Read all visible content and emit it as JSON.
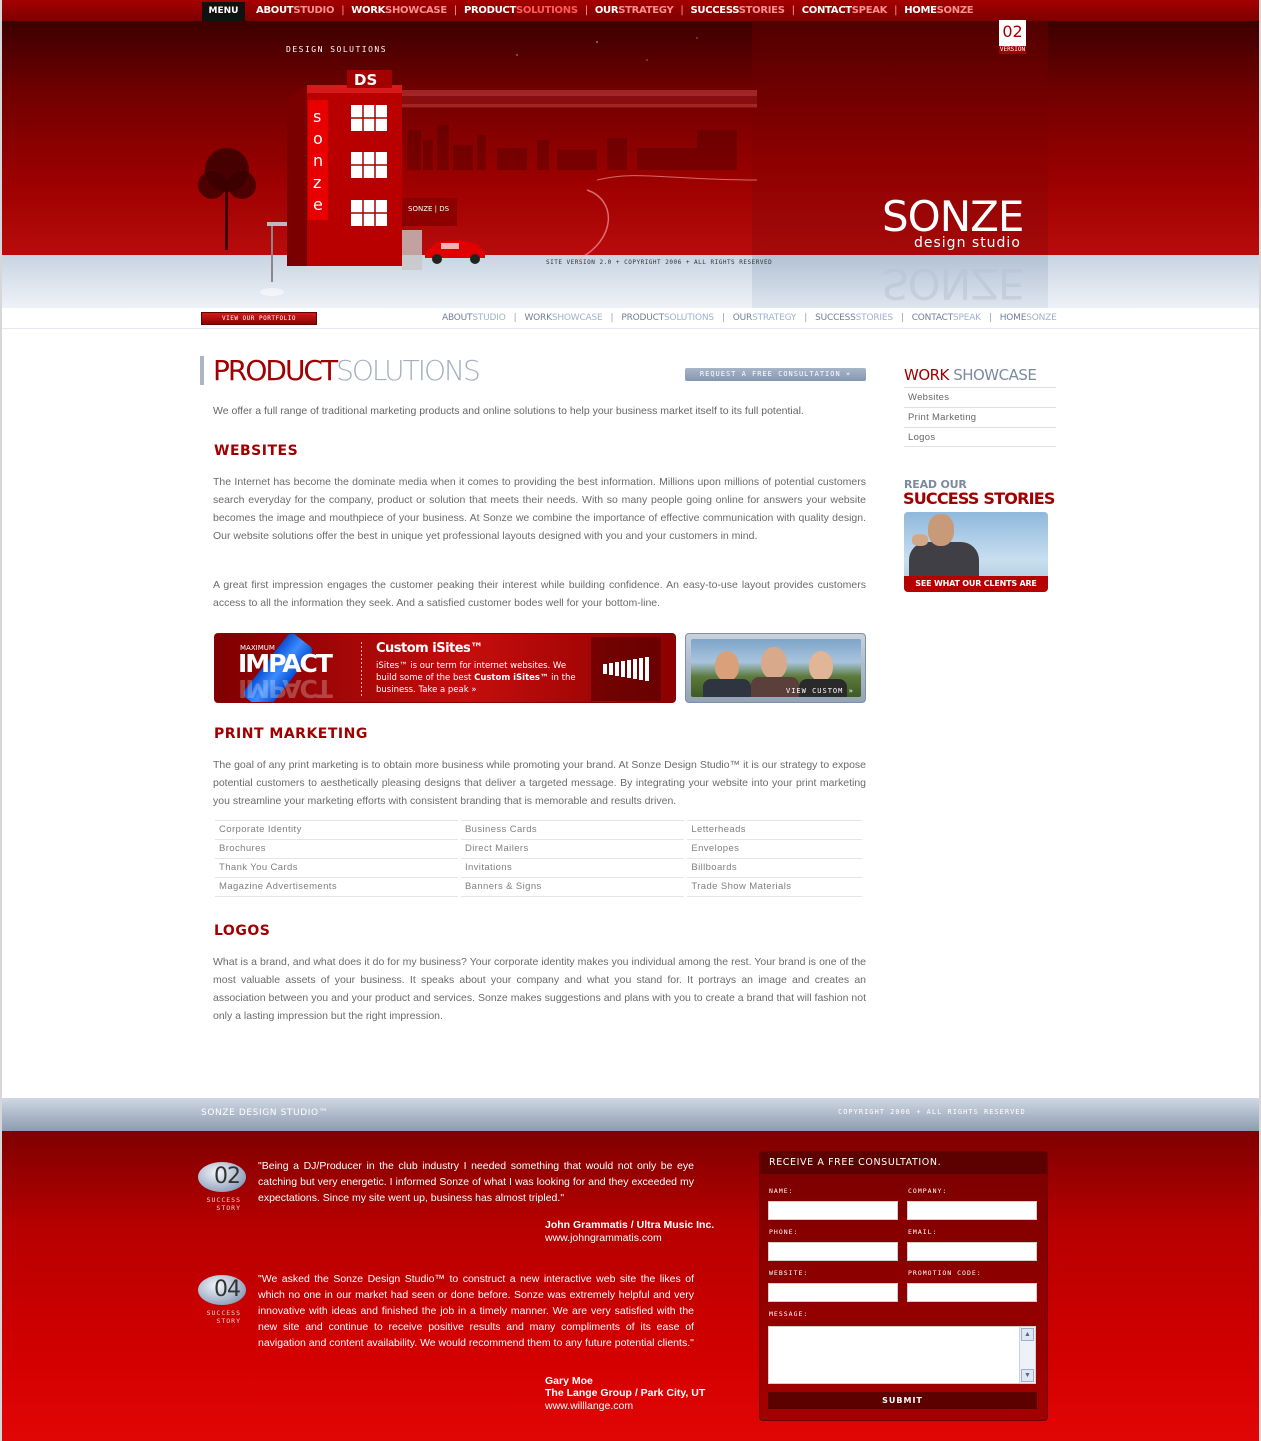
{
  "top_nav": {
    "menu_label": "MENU",
    "items": [
      {
        "a": "ABOUT",
        "b": "STUDIO"
      },
      {
        "a": "WORK",
        "b": "SHOWCASE"
      },
      {
        "a": "PRODUCT",
        "b": "SOLUTIONS"
      },
      {
        "a": "OUR",
        "b": "STRATEGY"
      },
      {
        "a": "SUCCESS",
        "b": "STORIES"
      },
      {
        "a": "CONTACT",
        "b": "SPEAK"
      },
      {
        "a": "HOME",
        "b": "SONZE"
      }
    ],
    "separator": "|"
  },
  "hero": {
    "version_number": "02",
    "version_word": "VERSION",
    "tagline": "DESIGN SOLUTIONS",
    "building_ds": "DS",
    "building_letters": "sonze",
    "sign_text": "SONZE | DS",
    "brand_name": "SONZE",
    "brand_sub": "design studio",
    "site_version": "SITE VERSION 2.0  +  COPYRIGHT 2006  +  ALL RIGHTS RESERVED"
  },
  "sub_nav": {
    "portfolio_button": "VIEW OUR PORTFOLIO",
    "items": [
      {
        "a": "ABOUT",
        "b": "STUDIO"
      },
      {
        "a": "WORK",
        "b": "SHOWCASE"
      },
      {
        "a": "PRODUCT",
        "b": "SOLUTIONS"
      },
      {
        "a": "OUR",
        "b": "STRATEGY"
      },
      {
        "a": "SUCCESS",
        "b": "STORIES"
      },
      {
        "a": "CONTACT",
        "b": "SPEAK"
      },
      {
        "a": "HOME",
        "b": "SONZE"
      }
    ],
    "separator": "|"
  },
  "main": {
    "title_a": "PRODUCT",
    "title_b": "SOLUTIONS",
    "consult_button": "REQUEST A FREE CONSULTATION »",
    "intro": "We offer a full range of traditional marketing products and online solutions to help your business market itself to its full potential.",
    "websites": {
      "heading": "WEBSITES",
      "p1": "The Internet has become the dominate media when it comes to providing the best information. Millions upon millions of potential customers search everyday for the company, product or solution that meets their needs. With so many people going online for answers your website becomes the image and mouthpiece of your business. At Sonze we combine the importance of effective communication with quality design. Our website solutions offer the best in unique yet professional layouts designed with you and your customers in mind.",
      "p2": "A great first impression engages the customer peaking their interest while building confidence. An easy-to-use layout provides customers access to all the information they seek. And a satisfied customer bodes well for your bottom-line."
    },
    "impact_banner": {
      "small": "MAXIMUM",
      "big": "IMPACT",
      "title": "Custom iSites™",
      "desc_1": "iSites™ is our term for internet websites. We build some of the best ",
      "desc_bold": "Custom iSites™",
      "desc_2": " in the business.  Take a peak »"
    },
    "custom_banner": {
      "label": "VIEW CUSTOM »"
    },
    "print": {
      "heading": "PRINT MARKETING",
      "p1": "The goal of any print marketing is to obtain more business while promoting your brand. At Sonze Design Studio™ it is our strategy to expose potential customers to aesthetically pleasing designs that deliver a targeted message. By integrating your website into your print marketing you streamline your marketing efforts with consistent branding that is memorable and results driven.",
      "table": [
        [
          "Corporate Identity",
          "Business Cards",
          "Letterheads"
        ],
        [
          "Brochures",
          "Direct Mailers",
          "Envelopes"
        ],
        [
          "Thank You Cards",
          "Invitations",
          "Billboards"
        ],
        [
          "Magazine Advertisements",
          "Banners & Signs",
          "Trade Show Materials"
        ]
      ]
    },
    "logos": {
      "heading": "LOGOS",
      "p1": "What is a brand, and what does it do for my business? Your corporate identity makes you individual among the rest. Your brand is one of the most valuable assets of your business. It speaks about your company and what you stand for. It portrays an image and creates an association between you and your product and services. Sonze makes suggestions and plans with you to create a brand that will fashion not only a lasting impression but the right impression."
    }
  },
  "sidebar": {
    "heading_a": "WORK",
    "heading_b": "SHOWCASE",
    "links": [
      "Websites",
      "Print Marketing",
      "Logos"
    ],
    "read_our": "READ OUR",
    "success_heading": "SUCCESS STORIES",
    "success_bar": "SEE WHAT OUR CLENTS ARE SAYING"
  },
  "footer": {
    "left": "SONZE DESIGN STUDIO™",
    "right": "COPYRIGHT 2006  +  ALL RIGHTS RESERVED",
    "stories": [
      {
        "num": "02",
        "word": "SUCCESS STORY",
        "quote": "\"Being a DJ/Producer in the club industry I needed something that would not only be eye catching but very energetic. I informed Sonze of what I was looking for and they exceeded my expectations. Since my site went up, business has almost tripled.\"",
        "author": "John Grammatis / Ultra Music Inc.",
        "url": "www.johngrammatis.com"
      },
      {
        "num": "04",
        "word": "SUCCESS STORY",
        "quote": "\"We asked the Sonze Design Studio™ to construct a new interactive web site the likes of which no one in our market had seen or done before. Sonze was extremely helpful and very innovative with ideas and finished the job in a timely manner. We are very satisfied with the new site and continue to receive positive results and many compliments of its ease of navigation and content availability. We would recommend them to any future potential clients.\"",
        "author_1": "Gary Moe",
        "author_2": "The Lange Group / Park City, UT",
        "url": "www.willlange.com"
      }
    ],
    "form": {
      "heading": "RECEIVE A FREE CONSULTATION.",
      "name": "NAME:",
      "company": "COMPANY:",
      "phone": "PHONE:",
      "email": "EMAIL:",
      "website": "WEBSITE:",
      "promo": "PROMOTION CODE:",
      "message": "MESSAGE:",
      "submit": "SUBMIT"
    }
  },
  "colors": {
    "brand_red": "#a10000",
    "nav_blue": "#6f7f99",
    "footer_red": "#d40000"
  }
}
